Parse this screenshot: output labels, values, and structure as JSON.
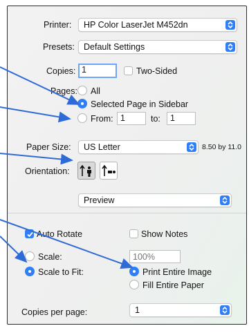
{
  "printer": {
    "label": "Printer:",
    "value": "HP Color LaserJet M452dn"
  },
  "presets": {
    "label": "Presets:",
    "value": "Default Settings"
  },
  "copies": {
    "label": "Copies:",
    "value": "1",
    "two_sided_label": "Two-Sided",
    "two_sided_checked": false
  },
  "pages": {
    "label": "Pages:",
    "all_label": "All",
    "selected_label": "Selected Page in Sidebar",
    "from_label": "From:",
    "from_value": "1",
    "to_label": "to:",
    "to_value": "1",
    "selected_option": "Selected Page in Sidebar"
  },
  "paper_size": {
    "label": "Paper Size:",
    "value": "US Letter",
    "dimensions": "8.50 by 11.0"
  },
  "orientation": {
    "label": "Orientation:",
    "selected": "portrait"
  },
  "section_popup": {
    "value": "Preview"
  },
  "preview_options": {
    "auto_rotate_label": "Auto Rotate",
    "auto_rotate_checked": true,
    "show_notes_label": "Show Notes",
    "show_notes_checked": false,
    "scale_label": "Scale:",
    "scale_placeholder": "100%",
    "scale_to_fit_label": "Scale to Fit:",
    "scale_mode": "Scale to Fit",
    "print_entire_image_label": "Print Entire Image",
    "fill_entire_paper_label": "Fill Entire Paper",
    "fit_mode": "Print Entire Image"
  },
  "copies_per_page": {
    "label": "Copies per page:",
    "value": "1"
  },
  "colors": {
    "accent": "#2f7ff6",
    "annotation_arrow": "#2f6bd6"
  }
}
